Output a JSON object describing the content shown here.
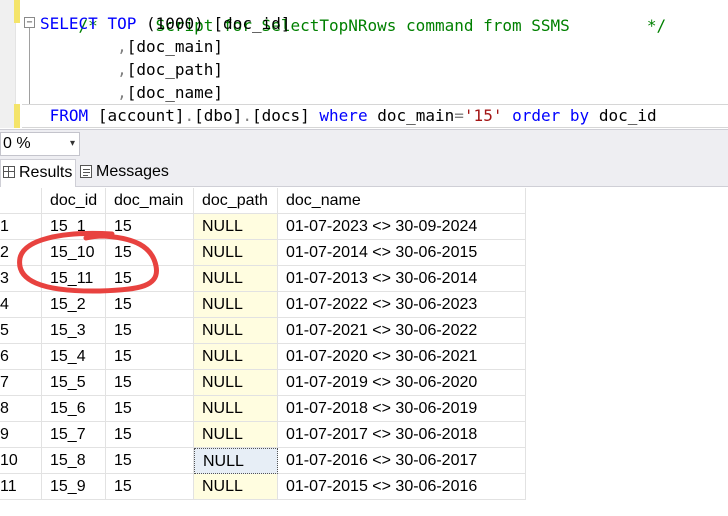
{
  "editor": {
    "comment_line": "/*      Script for SelectTopNRows command from SSMS        */",
    "collapse_glyph": "−",
    "lines": {
      "l1": {
        "kw1": "SELECT",
        "kw2": "TOP",
        "n": "(1000)",
        "col": "[doc_id]"
      },
      "l2": {
        "comma": ",",
        "col": "[doc_main]"
      },
      "l3": {
        "comma": ",",
        "col": "[doc_path]"
      },
      "l4": {
        "comma": ",",
        "col": "[doc_name]"
      },
      "l5": {
        "from": "FROM",
        "t1": "[account]",
        "dot1": ".",
        "t2": "[dbo]",
        "dot2": ".",
        "t3": "[docs]",
        "where": "where",
        "cond_col": "doc_main",
        "eq": "=",
        "cond_val": "'15'",
        "order": "order",
        "by": "by",
        "order_col": "doc_id"
      }
    }
  },
  "zoom": {
    "value": "0 %",
    "arrow": "▾"
  },
  "tabs": {
    "results": "Results",
    "messages": "Messages"
  },
  "grid": {
    "columns": [
      "",
      "doc_id",
      "doc_main",
      "doc_path",
      "doc_name"
    ],
    "rows": [
      [
        "1",
        "15_1",
        "15",
        "NULL",
        "01-07-2023 <> 30-09-2024"
      ],
      [
        "2",
        "15_10",
        "15",
        "NULL",
        "01-07-2014 <> 30-06-2015"
      ],
      [
        "3",
        "15_11",
        "15",
        "NULL",
        "01-07-2013 <> 30-06-2014"
      ],
      [
        "4",
        "15_2",
        "15",
        "NULL",
        "01-07-2022 <> 30-06-2023"
      ],
      [
        "5",
        "15_3",
        "15",
        "NULL",
        "01-07-2021 <> 30-06-2022"
      ],
      [
        "6",
        "15_4",
        "15",
        "NULL",
        "01-07-2020 <> 30-06-2021"
      ],
      [
        "7",
        "15_5",
        "15",
        "NULL",
        "01-07-2019 <> 30-06-2020"
      ],
      [
        "8",
        "15_6",
        "15",
        "NULL",
        "01-07-2018 <> 30-06-2019"
      ],
      [
        "9",
        "15_7",
        "15",
        "NULL",
        "01-07-2017 <> 30-06-2018"
      ],
      [
        "10",
        "15_8",
        "15",
        "NULL",
        "01-07-2016 <> 30-06-2017"
      ],
      [
        "11",
        "15_9",
        "15",
        "NULL",
        "01-07-2015 <> 30-06-2016"
      ]
    ]
  },
  "colors": {
    "keyword": "#0000ff",
    "string": "#a31515",
    "operator": "#808080",
    "null_cell": "#fffde0",
    "annotation": "#e8423f"
  }
}
